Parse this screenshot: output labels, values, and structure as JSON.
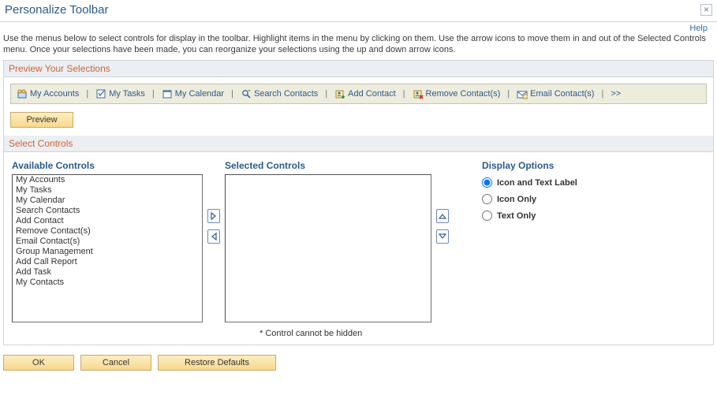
{
  "window": {
    "title": "Personalize Toolbar",
    "close_tooltip": "Close"
  },
  "help_link": "Help",
  "description": "Use the menus below to select controls for display in the toolbar. Highlight items in the menu by clicking on them. Use the arrow icons to move them in and out of the Selected Controls menu. Once your selections have been made, you can reorganize your selections using the up and down arrow icons.",
  "preview_section": {
    "heading": "Preview Your Selections",
    "items": [
      {
        "label": "My Accounts",
        "icon": "accounts"
      },
      {
        "label": "My Tasks",
        "icon": "tasks"
      },
      {
        "label": "My Calendar",
        "icon": "calendar"
      },
      {
        "label": "Search Contacts",
        "icon": "search"
      },
      {
        "label": "Add Contact",
        "icon": "add-contact"
      },
      {
        "label": "Remove Contact(s)",
        "icon": "remove-contact"
      },
      {
        "label": "Email Contact(s)",
        "icon": "email-contact"
      }
    ],
    "more_label": ">>",
    "preview_button": "Preview"
  },
  "select_section": {
    "heading": "Select Controls",
    "available_heading": "Available Controls",
    "selected_heading": "Selected Controls",
    "display_heading": "Display Options",
    "available": [
      "My Accounts",
      "My Tasks",
      "My Calendar",
      "Search Contacts",
      "Add Contact",
      "Remove Contact(s)",
      "Email Contact(s)",
      "Group Management",
      "Add Call Report",
      "Add Task",
      "My Contacts"
    ],
    "selected": [],
    "display_options": [
      {
        "label": "Icon and Text Label",
        "checked": true
      },
      {
        "label": "Icon Only",
        "checked": false
      },
      {
        "label": "Text Only",
        "checked": false
      }
    ],
    "footnote": "* Control cannot be hidden"
  },
  "buttons": {
    "ok": "OK",
    "cancel": "Cancel",
    "restore": "Restore Defaults"
  }
}
